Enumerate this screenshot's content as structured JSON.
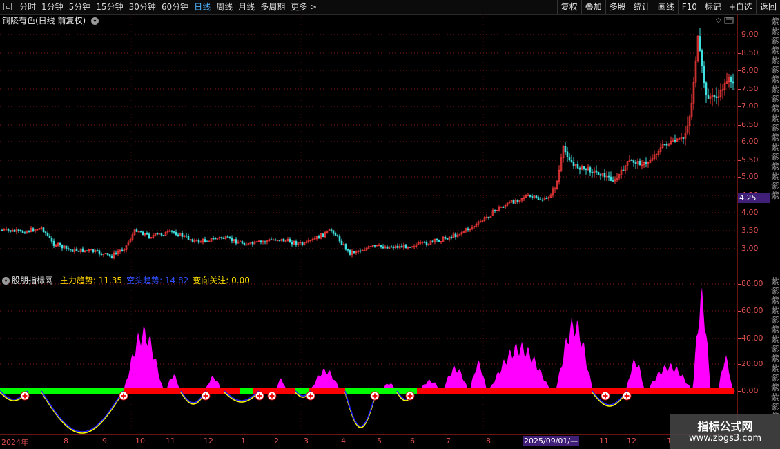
{
  "toolbar": {
    "tabs": [
      "分时",
      "1分钟",
      "5分钟",
      "15分钟",
      "30分钟",
      "60分钟",
      "日线",
      "周线",
      "月线",
      "多周期",
      "更多 >"
    ],
    "active_tab": "日线",
    "tools": [
      "复权",
      "叠加",
      "多股",
      "统计",
      "画线",
      "F10",
      "标记",
      "+自选",
      "返回"
    ]
  },
  "main_panel": {
    "title": "铜陵有色(日线 前复权)",
    "price_tag": "4.25",
    "y_labels": [
      "9.00",
      "8.50",
      "8.00",
      "7.50",
      "7.00",
      "6.50",
      "6.00",
      "5.50",
      "5.00",
      "4.50",
      "4.00",
      "3.50",
      "3.00"
    ]
  },
  "indicator_panel": {
    "name": "股朋指标网",
    "items": [
      {
        "label": "主力趋势:",
        "value": "11.35",
        "color": "#ffd000"
      },
      {
        "label": "空头趋势:",
        "value": "14.82",
        "color": "#3050ff"
      },
      {
        "label": "变向关注:",
        "value": "0.00",
        "color": "#ffe000"
      }
    ],
    "y_labels": [
      "80.00",
      "60.00",
      "40.00",
      "20.00",
      "0.00"
    ]
  },
  "x_axis": {
    "labels": [
      {
        "text": "2024年"
      },
      {
        "text": "8"
      },
      {
        "text": "9"
      },
      {
        "text": "10"
      },
      {
        "text": "11"
      },
      {
        "text": "12"
      },
      {
        "text": "1"
      },
      {
        "text": "2"
      },
      {
        "text": "3"
      },
      {
        "text": "4"
      },
      {
        "text": "5"
      },
      {
        "text": "6"
      },
      {
        "text": "7"
      },
      {
        "text": "8"
      },
      {
        "text": "11"
      },
      {
        "text": "12"
      },
      {
        "text": "1"
      }
    ],
    "date_tag": "2025/09/01/—"
  },
  "right_strip_chars": "紫紫紫紫紫紫紫紫紫紫紫紫紫紫紫紫紫紫紫",
  "watermark": {
    "line1": "指标公式网",
    "line2": "www.zbgs3.com"
  },
  "colors": {
    "up": "#ff3b3b",
    "down": "#3fe0e0",
    "magenta": "#ff00ff",
    "green": "#00ff00",
    "red": "#ff0000",
    "yellow": "#ffff00",
    "blue": "#2020ff",
    "grid": "#8a1a1a"
  }
}
